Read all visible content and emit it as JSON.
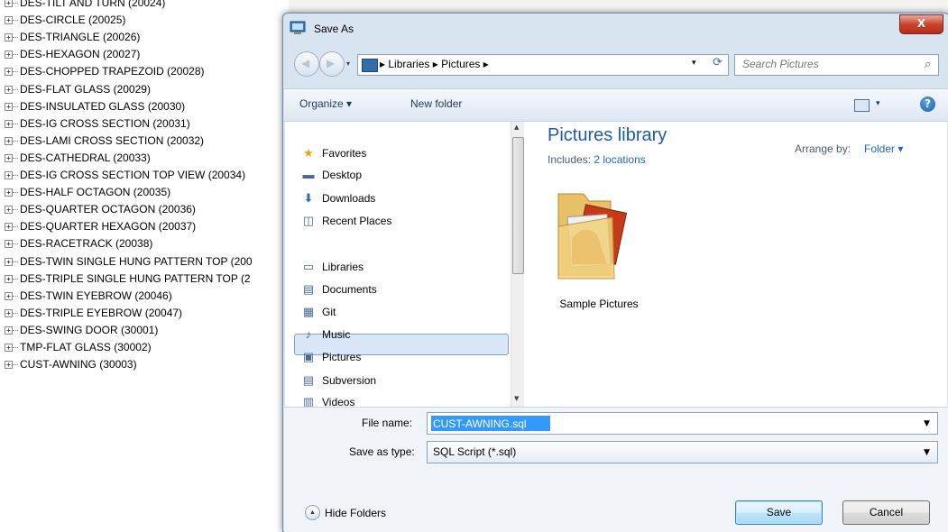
{
  "background_tree": {
    "items": [
      "DES-TILT AND TURN (20024)",
      "DES-CIRCLE (20025)",
      "DES-TRIANGLE (20026)",
      "DES-HEXAGON (20027)",
      "DES-CHOPPED TRAPEZOID (20028)",
      "DES-FLAT GLASS (20029)",
      "DES-INSULATED GLASS (20030)",
      "DES-IG CROSS SECTION (20031)",
      "DES-LAMI CROSS SECTION (20032)",
      "DES-CATHEDRAL (20033)",
      "DES-IG CROSS SECTION TOP VIEW (20034)",
      "DES-HALF OCTAGON (20035)",
      "DES-QUARTER OCTAGON (20036)",
      "DES-QUARTER HEXAGON (20037)",
      "DES-RACETRACK (20038)",
      "DES-TWIN SINGLE HUNG PATTERN TOP (200",
      "DES-TRIPLE SINGLE HUNG PATTERN TOP (2",
      "DES-TWIN EYEBROW (20046)",
      "DES-TRIPLE EYEBROW (20047)",
      "DES-SWING DOOR (30001)",
      "TMP-FLAT GLASS (30002)",
      "CUST-AWNING (30003)"
    ],
    "expander_glyph": "+"
  },
  "dialog": {
    "title": "Save As",
    "close_glyph": "X",
    "address": {
      "path": "▸  Libraries  ▸  Pictures  ▸",
      "dropdown_glyph": "▾",
      "refresh_glyph": "⟳"
    },
    "nav_arrows": {
      "back": "◀",
      "forward": "▶",
      "history": "▾"
    },
    "search": {
      "placeholder": "Search Pictures",
      "icon_glyph": "⌕"
    },
    "toolbar": {
      "organize": "Organize ▾",
      "new_folder": "New folder",
      "view_drop": "▾",
      "help": "?"
    },
    "nav_pane": {
      "items": [
        {
          "label": "Favorites",
          "icon": "star-icon",
          "glyph": "★"
        },
        {
          "label": "Desktop",
          "icon": "desktop-icon",
          "glyph": "▬"
        },
        {
          "label": "Downloads",
          "icon": "downloads-icon",
          "glyph": "⬇"
        },
        {
          "label": "Recent Places",
          "icon": "recent-places-icon",
          "glyph": "◫"
        },
        {
          "label": "Libraries",
          "icon": "libraries-icon",
          "glyph": "▭"
        },
        {
          "label": "Documents",
          "icon": "documents-icon",
          "glyph": "▤"
        },
        {
          "label": "Git",
          "icon": "git-icon",
          "glyph": "▦"
        },
        {
          "label": "Music",
          "icon": "music-icon",
          "glyph": "♪"
        },
        {
          "label": "Pictures",
          "icon": "pictures-icon",
          "glyph": "▣"
        },
        {
          "label": "Subversion",
          "icon": "subversion-icon",
          "glyph": "▤"
        },
        {
          "label": "Videos",
          "icon": "videos-icon",
          "glyph": "▥"
        }
      ],
      "scroll_up": "▲",
      "scroll_down": "▼"
    },
    "content": {
      "library_title": "Pictures library",
      "includes_label": "Includes:",
      "includes_link": "2 locations",
      "arrange_label": "Arrange by:",
      "arrange_value": "Folder ▾",
      "folder_label": "Sample Pictures"
    },
    "fields": {
      "file_name_label": "File name:",
      "file_name_value": "CUST-AWNING.sql",
      "save_type_label": "Save as type:",
      "save_type_value": "SQL Script (*.sql)",
      "dropdown_glyph": "▼"
    },
    "footer": {
      "hide_folders": "Hide Folders",
      "hide_glyph": "▲",
      "save": "Save",
      "cancel": "Cancel"
    }
  },
  "colors": {
    "accent": "#1e5aa8",
    "selection": "#3399ff",
    "close": "#c8452d"
  }
}
